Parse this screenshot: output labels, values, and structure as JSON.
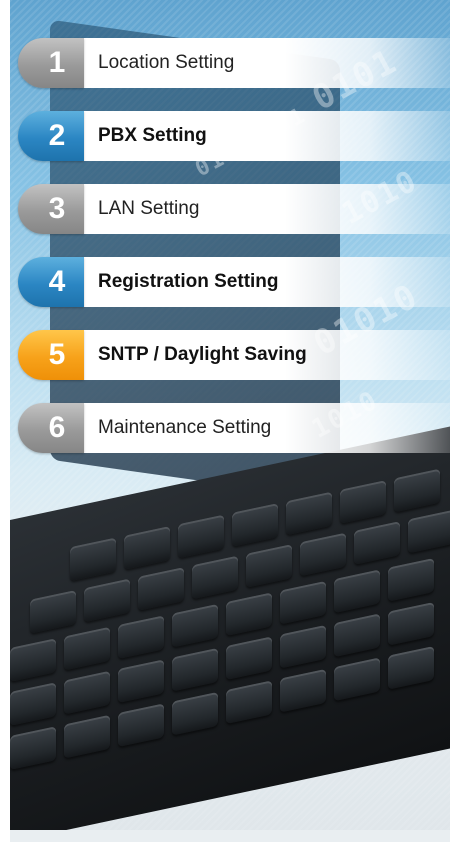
{
  "menu": {
    "items": [
      {
        "number": "1",
        "label": "Location Setting",
        "badge_color": "gray",
        "bold": false
      },
      {
        "number": "2",
        "label": "PBX Setting",
        "badge_color": "blue",
        "bold": true
      },
      {
        "number": "3",
        "label": "LAN Setting",
        "badge_color": "gray",
        "bold": false
      },
      {
        "number": "4",
        "label": "Registration Setting",
        "badge_color": "blue",
        "bold": true
      },
      {
        "number": "5",
        "label": "SNTP / Daylight Saving",
        "badge_color": "orange",
        "bold": true
      },
      {
        "number": "6",
        "label": "Maintenance Setting",
        "badge_color": "gray",
        "bold": false
      }
    ]
  },
  "background": {
    "binary_text": [
      "0101",
      "1010",
      "01010",
      "0101 101",
      "1010"
    ]
  },
  "colors": {
    "badge_gray": "#9a9a9a",
    "badge_blue": "#2b86c3",
    "badge_orange": "#f7a21a"
  }
}
